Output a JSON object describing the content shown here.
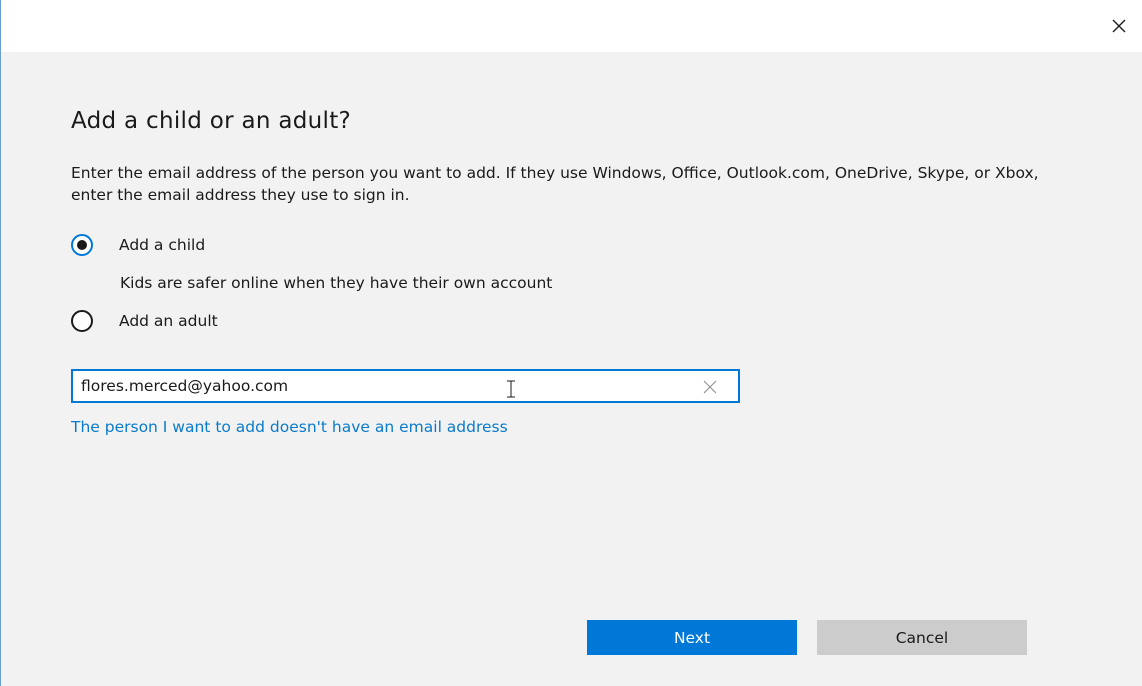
{
  "dialog": {
    "heading": "Add a child or an adult?",
    "description": "Enter the email address of the person you want to add. If they use Windows, Office, Outlook.com, OneDrive, Skype, or Xbox, enter the email address they use to sign in.",
    "options": [
      {
        "label": "Add a child",
        "checked": true,
        "sublabel": "Kids are safer online when they have their own account"
      },
      {
        "label": "Add an adult",
        "checked": false
      }
    ],
    "email_value": "flores.merced@yahoo.com",
    "no_email_link": "The person I want to add doesn't have an email address",
    "next_label": "Next",
    "cancel_label": "Cancel",
    "icons": {
      "close": "close-icon",
      "clear": "clear-icon",
      "cursor": "text-cursor-icon"
    }
  },
  "colors": {
    "accent": "#0078d7",
    "link": "#0a7bcc",
    "background": "#f2f2f2",
    "cancel_bg": "#cccccc"
  }
}
